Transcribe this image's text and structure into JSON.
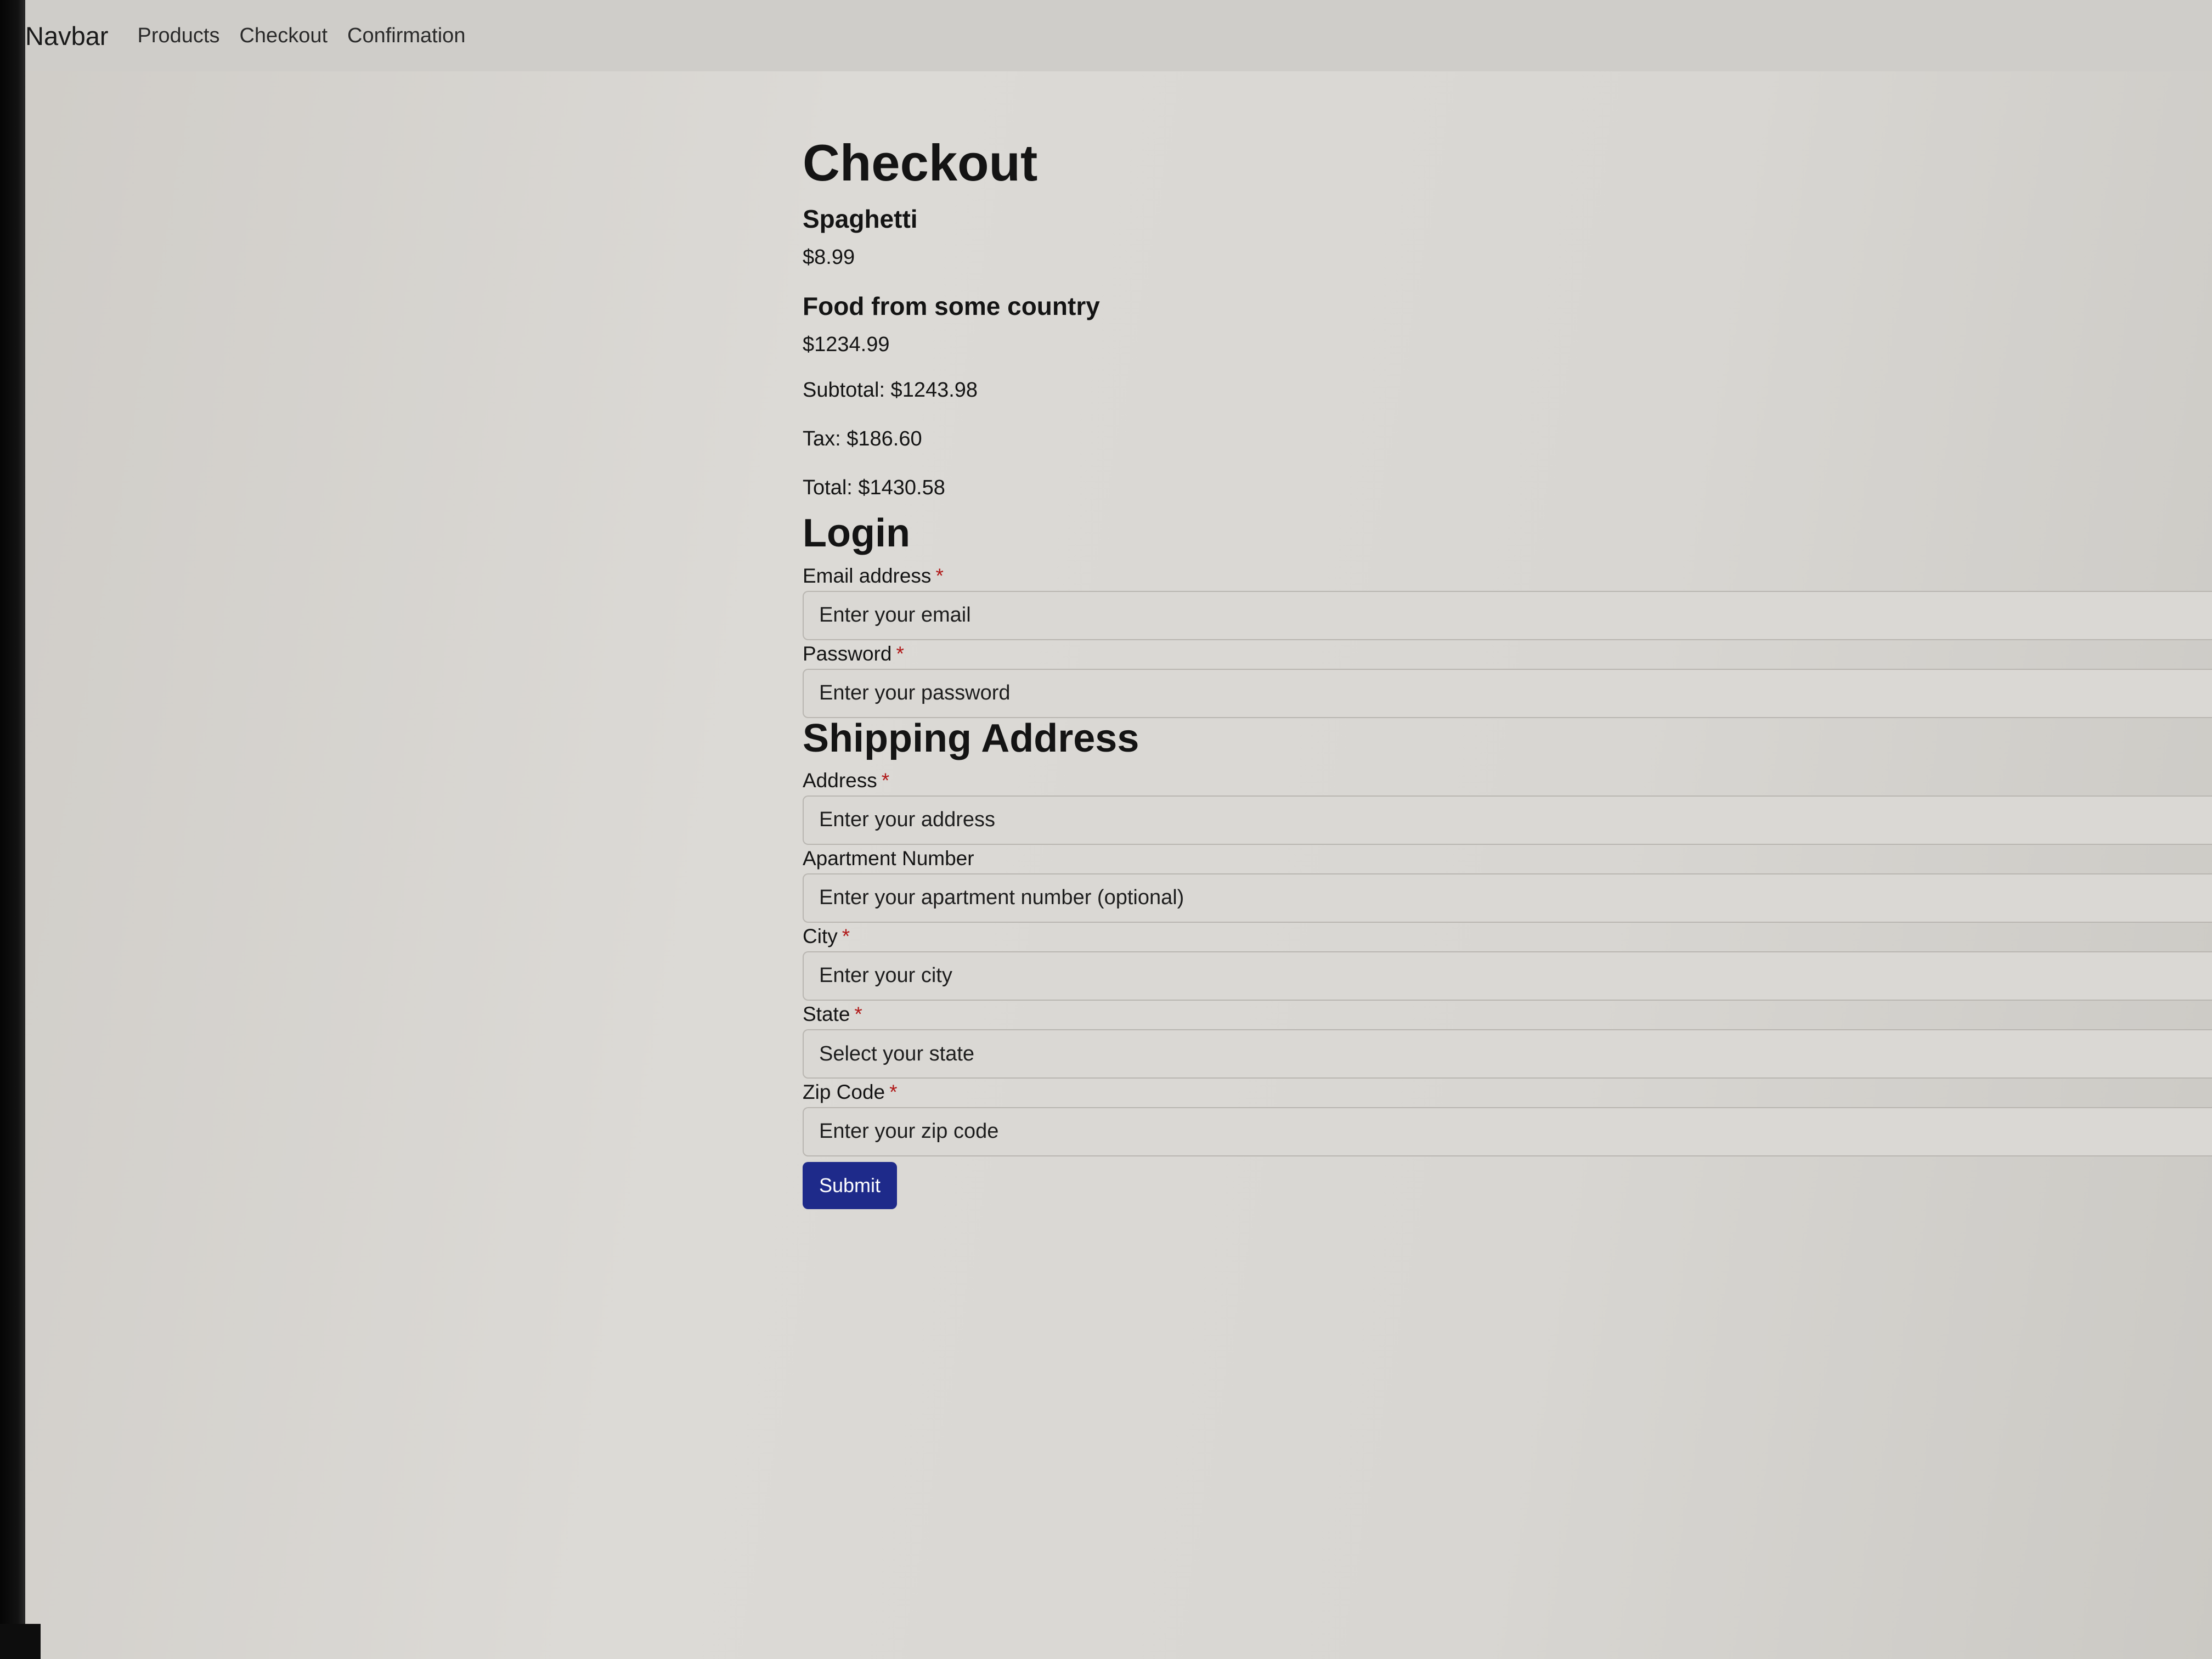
{
  "navbar": {
    "brand": "Navbar",
    "links": [
      "Products",
      "Checkout",
      "Confirmation"
    ]
  },
  "checkout": {
    "title": "Checkout",
    "items": [
      {
        "name": "Spaghetti",
        "price": "$8.99"
      },
      {
        "name": "Food from some country",
        "price": "$1234.99"
      }
    ],
    "subtotal": "Subtotal: $1243.98",
    "tax": "Tax: $186.60",
    "total": "Total: $1430.58"
  },
  "login": {
    "title": "Login",
    "email_label": "Email address",
    "email_placeholder": "Enter your email",
    "password_label": "Password",
    "password_placeholder": "Enter your password"
  },
  "shipping": {
    "title": "Shipping Address",
    "address_label": "Address",
    "address_placeholder": "Enter your address",
    "apartment_label": "Apartment Number",
    "apartment_placeholder": "Enter your apartment number (optional)",
    "city_label": "City",
    "city_placeholder": "Enter your city",
    "state_label": "State",
    "state_selected": "Select your state",
    "zip_label": "Zip Code",
    "zip_placeholder": "Enter your zip code"
  },
  "required_marker": "*",
  "submit_label": "Submit",
  "colors": {
    "submit_button": "#1e2a8a",
    "required_marker": "#b01818"
  }
}
